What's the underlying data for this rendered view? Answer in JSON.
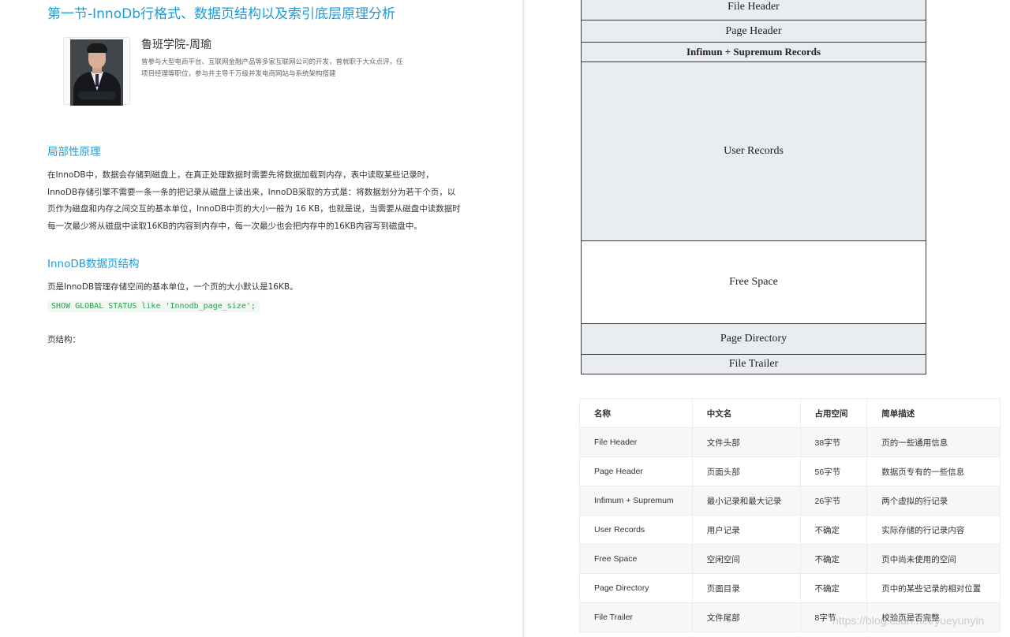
{
  "left": {
    "title": "第一节-InnoDb行格式、数据页结构以及索引底层原理分析",
    "author": {
      "name": "鲁班学院-周瑜",
      "bio_line1": "曾参与大型电商平台、互联网金融产品等多家互联网公司的开发，曾就职于大众点评，任",
      "bio_line2": "项目经理等职位，参与并主导千万级并发电商网站与系统架构搭建"
    },
    "section1": {
      "heading": "局部性原理",
      "lines": [
        "在InnoDB中，数据会存储到磁盘上，在真正处理数据时需要先将数据加载到内存，表中读取某些记录时，",
        "InnoDB存储引擎不需要一条一条的把记录从磁盘上读出来，InnoDB采取的方式是：将数据划分为若干个页，以",
        "页作为磁盘和内存之间交互的基本单位，InnoDB中页的大小一般为 16 KB，也就是说，当需要从磁盘中读数据时",
        "每一次最少将从磁盘中读取16KB的内容到内存中，每一次最少也会把内存中的16KB内容写到磁盘中。"
      ]
    },
    "section2": {
      "heading": "InnoDB数据页结构",
      "text": "页是InnoDB管理存储空间的基本单位，一个页的大小默认是16KB。",
      "code": "SHOW GLOBAL STATUS like 'Innodb_page_size';",
      "page_structure_label": "页结构："
    }
  },
  "diagram": {
    "segments": [
      "File Header",
      "Page Header",
      "Infimun + Supremum Records",
      "User Records",
      "Free Space",
      "Page Directory",
      "File Trailer"
    ]
  },
  "table": {
    "headers": [
      "名称",
      "中文名",
      "占用空间",
      "简单描述"
    ],
    "rows": [
      [
        "File Header",
        "文件头部",
        "38字节",
        "页的一些通用信息"
      ],
      [
        "Page Header",
        "页面头部",
        "56字节",
        "数据页专有的一些信息"
      ],
      [
        "Infimum + Supremum",
        "最小记录和最大记录",
        "26字节",
        "两个虚拟的行记录"
      ],
      [
        "User Records",
        "用户记录",
        "不确定",
        "实际存储的行记录内容"
      ],
      [
        "Free Space",
        "空闲空间",
        "不确定",
        "页中尚未使用的空间"
      ],
      [
        "Page Directory",
        "页面目录",
        "不确定",
        "页中的某些记录的相对位置"
      ],
      [
        "File Trailer",
        "文件尾部",
        "8字节",
        "校验页是否完整"
      ]
    ]
  },
  "watermark": "https://blog.csdn.net/yueyunyin"
}
